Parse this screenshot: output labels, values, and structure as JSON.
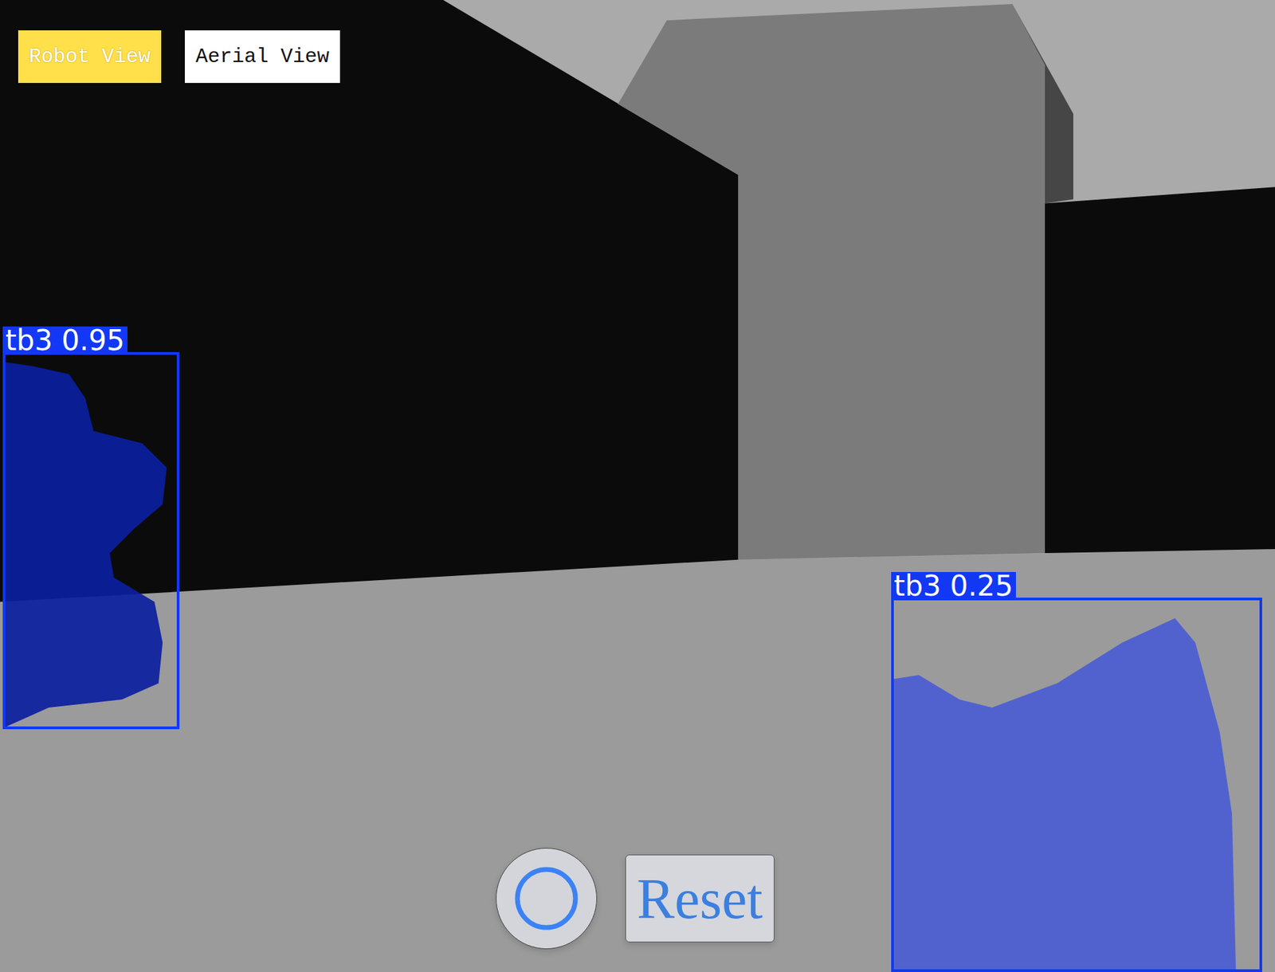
{
  "view_tabs": [
    {
      "label": "Robot View",
      "selected": true
    },
    {
      "label": "Aerial View",
      "selected": false
    }
  ],
  "camera_feed": {
    "detections": [
      {
        "label": "tb3 0.95"
      },
      {
        "label": "tb3 0.25"
      }
    ]
  },
  "controls": {
    "reset_button": "Reset"
  }
}
